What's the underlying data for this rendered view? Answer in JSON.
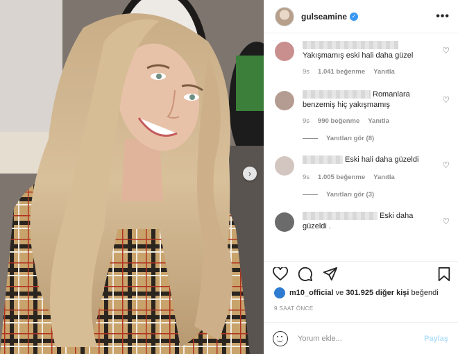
{
  "profile": {
    "username": "gulseamine",
    "verified_icon": "verified-badge-icon",
    "more_icon": "more-options-icon"
  },
  "comments": [
    {
      "text": "Yakışmamış eski hali daha güzel",
      "time": "9s",
      "likes": "1.041 beğenme",
      "reply": "Yanıtla"
    },
    {
      "text": "Romanlara benzemiş hiç yakışmamış",
      "time": "9s",
      "likes": "990 beğenme",
      "reply": "Yanıtla",
      "view_replies": "Yanıtları gör (8)"
    },
    {
      "text": "Eski hali daha güzeldi",
      "time": "9s",
      "likes": "1.005 beğenme",
      "reply": "Yanıtla",
      "view_replies": "Yanıtları gör (3)"
    },
    {
      "text": "Eski daha güzeldi .",
      "time": "",
      "likes": "",
      "reply": ""
    }
  ],
  "likes": {
    "user": "m10_official",
    "connector": " ve ",
    "others": "301.925 diğer kişi",
    "suffix": " beğendi"
  },
  "timestamp": "9 SAAT ÖNCE",
  "add_comment": {
    "placeholder": "Yorum ekle...",
    "post_label": "Paylaş"
  },
  "icons": [
    "heart-icon",
    "comment-icon",
    "share-icon",
    "bookmark-icon",
    "emoji-icon",
    "next-arrow-icon"
  ],
  "colors": {
    "accent": "#3897f0",
    "post_disabled": "#b2dffc",
    "meta": "#8e8e8e"
  }
}
